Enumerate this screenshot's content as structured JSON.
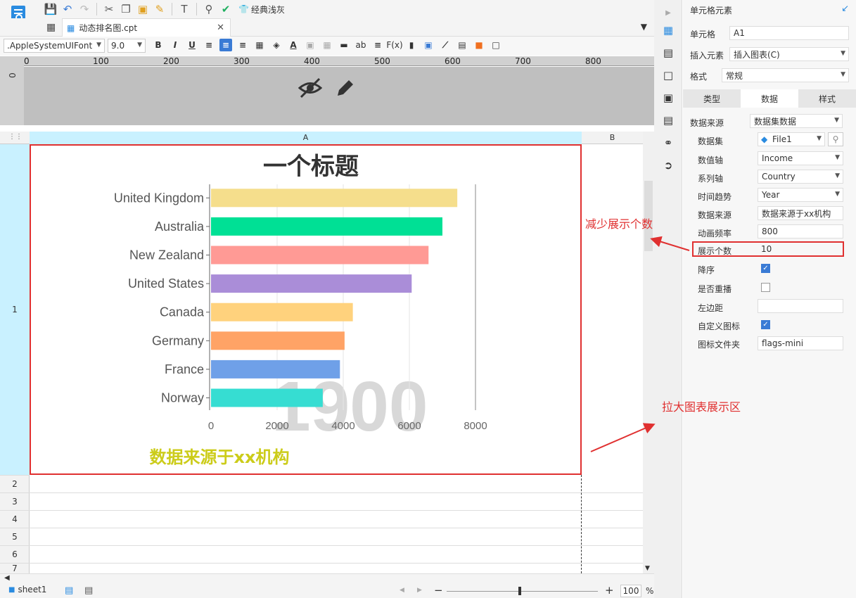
{
  "toolbar": {
    "theme_label": "经典浅灰"
  },
  "tab": {
    "filename": "动态排名图.cpt"
  },
  "format": {
    "font_family": ".AppleSystemUIFont",
    "font_size": "9.0"
  },
  "ruler": {
    "h_labels": [
      "0",
      "100",
      "200",
      "300",
      "400",
      "500",
      "600",
      "700",
      "800"
    ],
    "v_label": "0"
  },
  "grid": {
    "col_a": "A",
    "col_b": "B",
    "rows": [
      "1",
      "2",
      "3",
      "4",
      "5",
      "6",
      "7"
    ]
  },
  "chart_data": {
    "type": "bar",
    "title": "一个标题",
    "categories": [
      "United Kingdom",
      "Australia",
      "New Zealand",
      "United States",
      "Canada",
      "Germany",
      "France",
      "Norway"
    ],
    "values": [
      7450,
      7000,
      6580,
      6070,
      4290,
      4040,
      3900,
      3380
    ],
    "colors": [
      "#f5de8c",
      "#00e095",
      "#ff9a95",
      "#aa8dd8",
      "#ffd27d",
      "#ffa366",
      "#6fa0e8",
      "#36ddd2"
    ],
    "xlim": [
      0,
      8000
    ],
    "x_ticks": [
      "0",
      "2000",
      "4000",
      "6000",
      "8000"
    ],
    "watermark_year": "1900",
    "source_text": "数据来源于xx机构",
    "source_color": "#cccc1a"
  },
  "bottom": {
    "sheet_name": "sheet1",
    "zoom": "100",
    "zoom_unit": "%"
  },
  "panel": {
    "header": "单元格元素",
    "cell_label": "单元格",
    "cell_value": "A1",
    "insert_label": "插入元素",
    "insert_value": "插入图表(C)",
    "format_label": "格式",
    "format_value": "常规",
    "tabs": [
      "类型",
      "数据",
      "样式"
    ],
    "fields": [
      {
        "label": "数据来源",
        "value": "数据集数据"
      },
      {
        "label": "数据集",
        "value": "File1"
      },
      {
        "label": "数值轴",
        "value": "Income"
      },
      {
        "label": "系列轴",
        "value": "Country"
      },
      {
        "label": "时间趋势",
        "value": "Year"
      },
      {
        "label": "数据来源",
        "value": "数据来源于xx机构"
      },
      {
        "label": "动画频率",
        "value": "800"
      },
      {
        "label": "展示个数",
        "value": "10"
      },
      {
        "label": "降序",
        "value": ""
      },
      {
        "label": "是否重播",
        "value": ""
      },
      {
        "label": "左边距",
        "value": ""
      },
      {
        "label": "自定义图标",
        "value": ""
      },
      {
        "label": "图标文件夹",
        "value": "flags-mini"
      }
    ]
  },
  "annotations": {
    "reduce_count": "减少展示个数",
    "enlarge_area": "拉大图表展示区"
  },
  "colors": {
    "accent": "#3a7bd5",
    "highlight": "#e03030",
    "selection": "#c9f1ff"
  }
}
